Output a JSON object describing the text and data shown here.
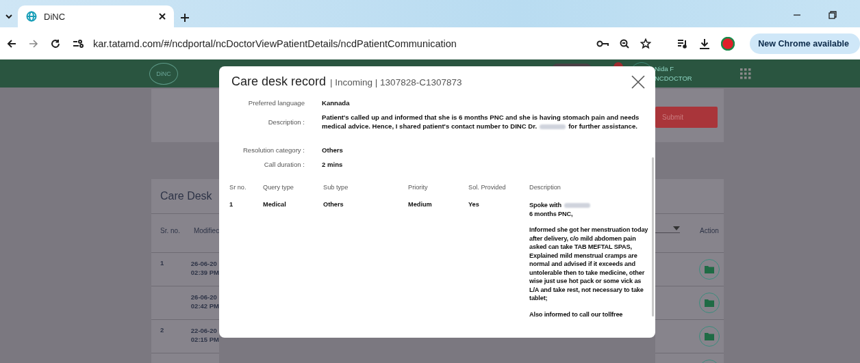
{
  "browser": {
    "tab": {
      "title": "DiNC",
      "selected": true
    },
    "url": "kar.tatamd.com/#/ncdportal/ncDoctorViewPatientDetails/ncdPatientCommunication",
    "update_button": "New Chrome available"
  },
  "header": {
    "logo_text": "DiNC",
    "user_name": "Nida F",
    "user_role": "NCDOCTOR"
  },
  "form_card": {
    "submit_button": "Submit"
  },
  "records_card": {
    "title": "Care Desk",
    "columns": [
      "Sr. no.",
      "Modifiec"
    ],
    "last_column": "Action",
    "rows": [
      {
        "sr_no": "1",
        "modified": [
          "26-06-20",
          "02:39 PM"
        ]
      },
      {
        "modified": [
          "26-06-20",
          "02:42 PM"
        ]
      },
      {
        "sr_no": "2",
        "modified": [
          "22-06-20",
          "02:15 PM"
        ]
      }
    ]
  },
  "modal": {
    "title": "Care desk record",
    "subtitle": "| Incoming | 1307828-C1307873",
    "details": [
      {
        "label": "Preferred language",
        "kind": "text",
        "value": "Kannada"
      },
      {
        "label": "Description :",
        "kind": "redacted",
        "before": "Patient's called up and informed that she is 6 months PNC and she is having stomach pain and needs medical advice. Hence, I shared patient's contact number to DINC Dr.",
        "after": "for further assistance."
      },
      {
        "label": "Resolution category :",
        "kind": "text",
        "value": "Others"
      },
      {
        "label": "Call duration :",
        "kind": "text",
        "value": "2 mins"
      }
    ],
    "table": {
      "columns": [
        "Sr no.",
        "Query type",
        "Sub type",
        "Priority",
        "Sol. Provided",
        "Description"
      ],
      "rows": [
        {
          "sr_no": "1",
          "query_type": "Medical",
          "sub_type": "Others",
          "priority": "Medium",
          "solution_provided": "Yes",
          "description": [
            {
              "kind": "redacted",
              "text": "Spoke with"
            },
            {
              "kind": "line",
              "text": "6 months PNC,"
            },
            {
              "kind": "paragraph",
              "text": "Informed she got her menstruation today after delivery, c/o mild abdomen pain asked can take TAB MEFTAL SPAS, Explained mild menstrual cramps are normal and advised if it exceeds and untolerable then to take medicine, other wise just use hot pack or some vick as L/A and take rest, not necessary to take tablet;"
            },
            {
              "kind": "paragraph",
              "text": "Also informed to call our tollfree"
            }
          ]
        }
      ]
    }
  }
}
